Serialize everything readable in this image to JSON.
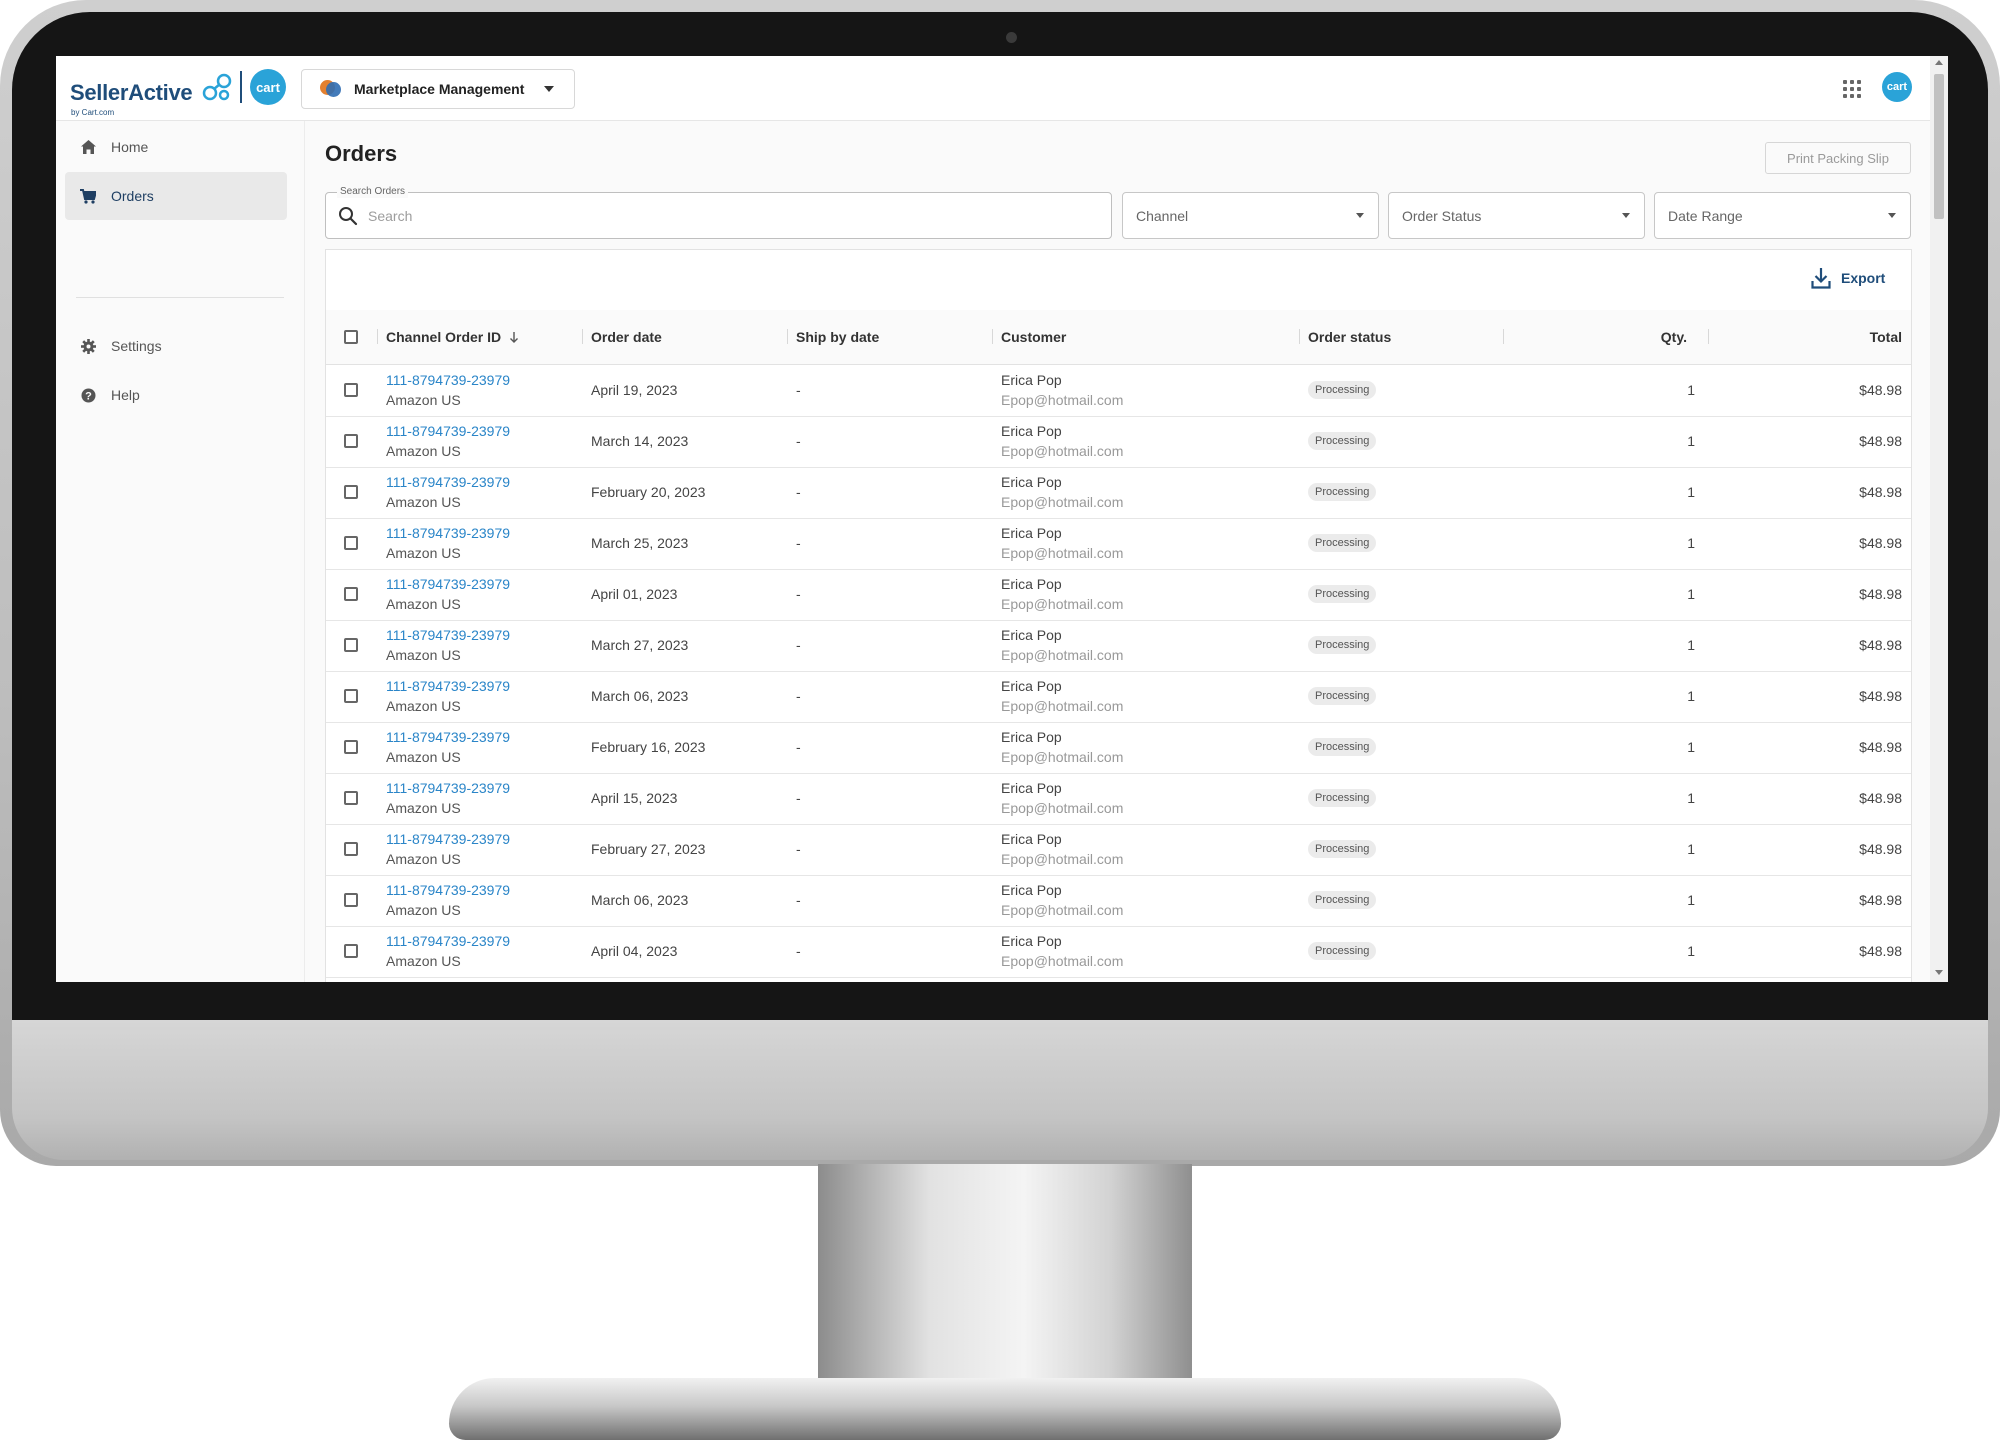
{
  "brand": {
    "name": "SellerActive",
    "tagline": "by Cart.com",
    "cart_logo_text": "cart",
    "accent_color": "#1f4d7a",
    "link_color": "#2a85c8",
    "cart_color": "#2aa3d8"
  },
  "header": {
    "app_switcher_label": "Marketplace Management",
    "apps_icon": "grid-icon",
    "account_badge": "cart"
  },
  "sidebar": {
    "items": [
      {
        "label": "Home",
        "icon": "home-icon"
      },
      {
        "label": "Orders",
        "icon": "cart-icon",
        "active": true
      },
      {
        "label": "Settings",
        "icon": "gear-icon"
      },
      {
        "label": "Help",
        "icon": "help-icon"
      }
    ]
  },
  "page": {
    "title": "Orders",
    "print_button": "Print Packing Slip",
    "search": {
      "label": "Search Orders",
      "placeholder": "Search",
      "value": ""
    },
    "filters": {
      "channel": "Channel",
      "order_status": "Order Status",
      "date_range": "Date Range"
    },
    "export_label": "Export"
  },
  "table": {
    "columns": {
      "order_id": "Channel Order ID",
      "order_date": "Order date",
      "ship_by": "Ship by date",
      "customer": "Customer",
      "status": "Order status",
      "qty": "Qty.",
      "total": "Total"
    },
    "sort_indicator": "arrow-down-icon",
    "rows": [
      {
        "order_id": "111-8794739-23979",
        "channel": "Amazon US",
        "order_date": "April 19, 2023",
        "ship_by": "-",
        "customer": "Erica Pop",
        "email": "Epop@hotmail.com",
        "status": "Processing",
        "qty": "1",
        "total": "$48.98"
      },
      {
        "order_id": "111-8794739-23979",
        "channel": "Amazon US",
        "order_date": "March 14, 2023",
        "ship_by": "-",
        "customer": "Erica Pop",
        "email": "Epop@hotmail.com",
        "status": "Processing",
        "qty": "1",
        "total": "$48.98"
      },
      {
        "order_id": "111-8794739-23979",
        "channel": "Amazon US",
        "order_date": "February 20, 2023",
        "ship_by": "-",
        "customer": "Erica Pop",
        "email": "Epop@hotmail.com",
        "status": "Processing",
        "qty": "1",
        "total": "$48.98"
      },
      {
        "order_id": "111-8794739-23979",
        "channel": "Amazon US",
        "order_date": "March 25, 2023",
        "ship_by": "-",
        "customer": "Erica Pop",
        "email": "Epop@hotmail.com",
        "status": "Processing",
        "qty": "1",
        "total": "$48.98"
      },
      {
        "order_id": "111-8794739-23979",
        "channel": "Amazon US",
        "order_date": "April 01, 2023",
        "ship_by": "-",
        "customer": "Erica Pop",
        "email": "Epop@hotmail.com",
        "status": "Processing",
        "qty": "1",
        "total": "$48.98"
      },
      {
        "order_id": "111-8794739-23979",
        "channel": "Amazon US",
        "order_date": "March 27, 2023",
        "ship_by": "-",
        "customer": "Erica Pop",
        "email": "Epop@hotmail.com",
        "status": "Processing",
        "qty": "1",
        "total": "$48.98"
      },
      {
        "order_id": "111-8794739-23979",
        "channel": "Amazon US",
        "order_date": "March 06, 2023",
        "ship_by": "-",
        "customer": "Erica Pop",
        "email": "Epop@hotmail.com",
        "status": "Processing",
        "qty": "1",
        "total": "$48.98"
      },
      {
        "order_id": "111-8794739-23979",
        "channel": "Amazon US",
        "order_date": "February 16, 2023",
        "ship_by": "-",
        "customer": "Erica Pop",
        "email": "Epop@hotmail.com",
        "status": "Processing",
        "qty": "1",
        "total": "$48.98"
      },
      {
        "order_id": "111-8794739-23979",
        "channel": "Amazon US",
        "order_date": "April 15, 2023",
        "ship_by": "-",
        "customer": "Erica Pop",
        "email": "Epop@hotmail.com",
        "status": "Processing",
        "qty": "1",
        "total": "$48.98"
      },
      {
        "order_id": "111-8794739-23979",
        "channel": "Amazon US",
        "order_date": "February 27, 2023",
        "ship_by": "-",
        "customer": "Erica Pop",
        "email": "Epop@hotmail.com",
        "status": "Processing",
        "qty": "1",
        "total": "$48.98"
      },
      {
        "order_id": "111-8794739-23979",
        "channel": "Amazon US",
        "order_date": "March 06, 2023",
        "ship_by": "-",
        "customer": "Erica Pop",
        "email": "Epop@hotmail.com",
        "status": "Processing",
        "qty": "1",
        "total": "$48.98"
      },
      {
        "order_id": "111-8794739-23979",
        "channel": "Amazon US",
        "order_date": "April 04, 2023",
        "ship_by": "-",
        "customer": "Erica Pop",
        "email": "Epop@hotmail.com",
        "status": "Processing",
        "qty": "1",
        "total": "$48.98"
      }
    ]
  }
}
